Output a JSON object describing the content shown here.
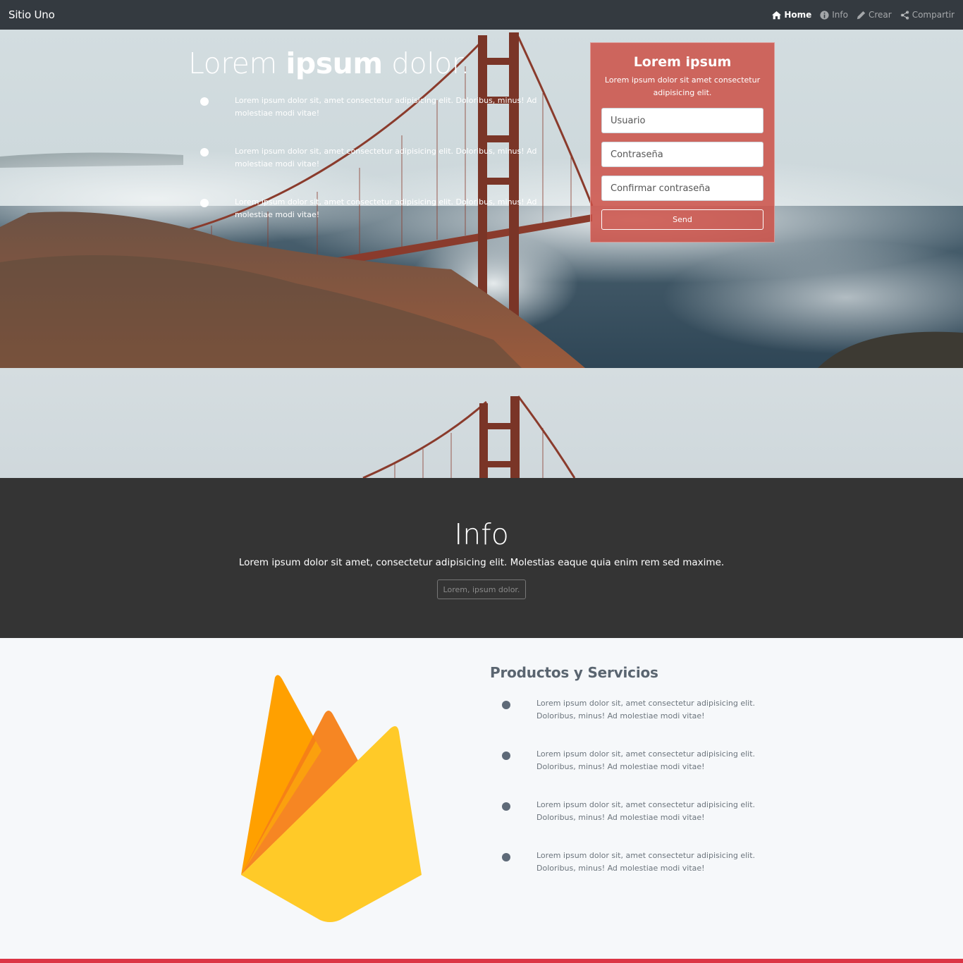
{
  "navbar": {
    "brand": "Sitio Uno",
    "items": [
      {
        "label": "Home",
        "icon": "home-icon",
        "active": true
      },
      {
        "label": "Info",
        "icon": "info-icon",
        "active": false
      },
      {
        "label": "Crear",
        "icon": "pencil-icon",
        "active": false
      },
      {
        "label": "Compartir",
        "icon": "share-icon",
        "active": false
      }
    ]
  },
  "hero": {
    "title_light": "Lorem ",
    "title_bold": "ipsum",
    "title_end": " dolor.",
    "items": [
      "Lorem ipsum dolor sit, amet consectetur adipisicing elit. Doloribus, minus! Ad molestiae modi vitae!",
      "Lorem ipsum dolor sit, amet consectetur adipisicing elit. Doloribus, minus! Ad molestiae modi vitae!",
      "Lorem ipsum dolor sit, amet consectetur adipisicing elit. Doloribus, minus! Ad molestiae modi vitae!"
    ]
  },
  "form": {
    "title": "Lorem ipsum",
    "subtitle": "Lorem ipsum dolor sit amet consectetur adipisicing elit.",
    "user_placeholder": "Usuario",
    "password_placeholder": "Contraseña",
    "confirm_placeholder": "Confirmar contraseña",
    "send_label": "Send"
  },
  "info": {
    "title": "Info",
    "text": "Lorem ipsum dolor sit amet, consectetur adipisicing elit. Molestias eaque quia enim rem sed maxime.",
    "button_label": "Lorem, ipsum dolor."
  },
  "products": {
    "title": "Productos y Servicios",
    "items": [
      "Lorem ipsum dolor sit, amet consectetur adipisicing elit. Doloribus, minus! Ad molestiae modi vitae!",
      "Lorem ipsum dolor sit, amet consectetur adipisicing elit. Doloribus, minus! Ad molestiae modi vitae!",
      "Lorem ipsum dolor sit, amet consectetur adipisicing elit. Doloribus, minus! Ad molestiae modi vitae!",
      "Lorem ipsum dolor sit, amet consectetur adipisicing elit. Doloribus, minus! Ad molestiae modi vitae!"
    ]
  },
  "colors": {
    "navbar": "#343a40",
    "form_card": "#cd5046",
    "info_bg": "#343434",
    "products_bg": "#f6f8fa",
    "footer_accent": "#dc3545",
    "bridge": "#8a3b2c"
  }
}
